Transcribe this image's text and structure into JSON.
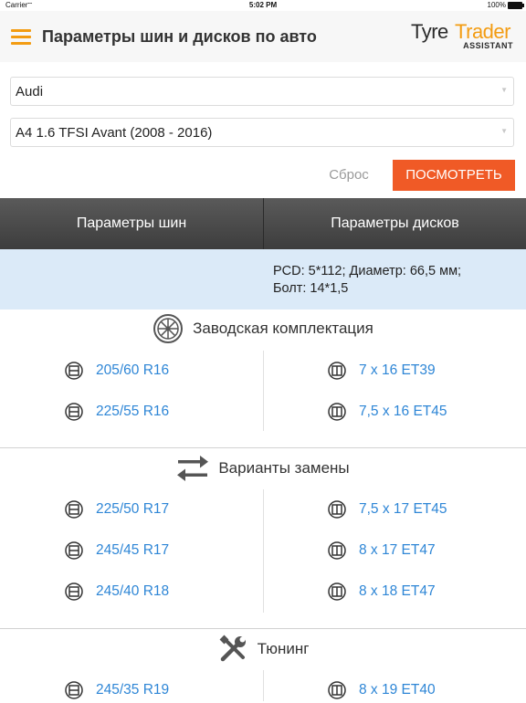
{
  "status_bar": {
    "carrier": "Carrier",
    "time": "5:02 PM",
    "battery": "100%"
  },
  "header": {
    "title": "Параметры шин и дисков по авто",
    "logo": {
      "word1": "Tyre",
      "word2": "Trader",
      "word3": "ASSISTANT"
    }
  },
  "selection": {
    "make": "Audi",
    "model": "A4 1.6 TFSI Avant (2008 - 2016)"
  },
  "actions": {
    "reset_label": "Сброс",
    "view_label": "ПОСМОТРЕТЬ"
  },
  "tabs": {
    "tires": "Параметры шин",
    "wheels": "Параметры дисков"
  },
  "info": {
    "line1": "PCD: 5*112; Диаметр: 66,5 мм;",
    "line2": "Болт: 14*1,5"
  },
  "sections": {
    "factory": {
      "title": "Заводская комплектация",
      "tires": [
        "205/60 R16",
        "225/55 R16"
      ],
      "wheels": [
        "7 x 16 ET39",
        "7,5 x 16 ET45"
      ]
    },
    "replacement": {
      "title": "Варианты замены",
      "tires": [
        "225/50 R17",
        "245/45 R17",
        "245/40 R18"
      ],
      "wheels": [
        "7,5 x 17 ET45",
        "8 x 17 ET47",
        "8 x 18 ET47"
      ]
    },
    "tuning": {
      "title": "Тюнинг",
      "tires": [
        "245/35 R19"
      ],
      "wheels": [
        "8 x 19 ET40"
      ]
    }
  },
  "colors": {
    "accent": "#f05a26",
    "logo_orange": "#f39c12",
    "link": "#2e86d6",
    "info_bg": "#dbeaf8"
  }
}
